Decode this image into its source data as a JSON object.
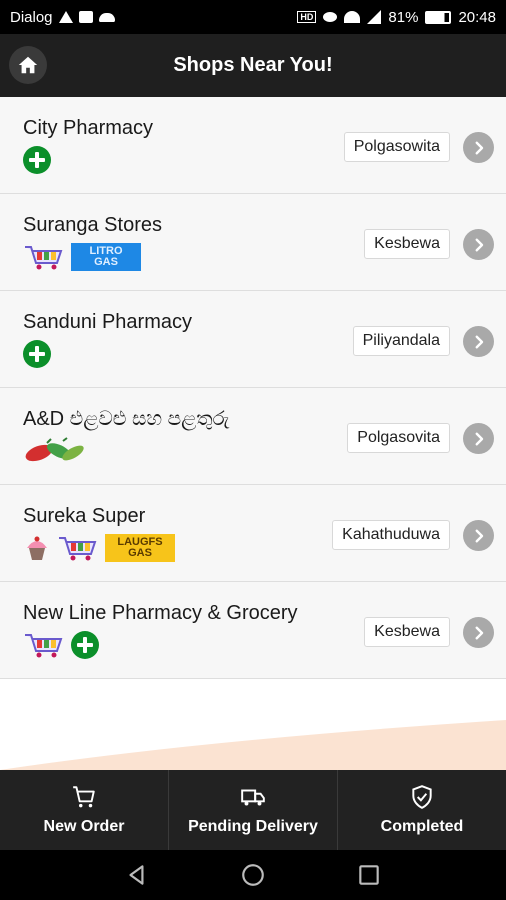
{
  "status_bar": {
    "carrier": "Dialog",
    "battery": "81%",
    "time": "20:48"
  },
  "header": {
    "title": "Shops Near You!"
  },
  "shops": [
    {
      "name": "City Pharmacy",
      "location": "Polgasowita",
      "badges": [
        "pharmacy-cross"
      ]
    },
    {
      "name": "Suranga Stores",
      "location": "Kesbewa",
      "badges": [
        "grocery-cart",
        "litro-gas"
      ]
    },
    {
      "name": "Sanduni Pharmacy",
      "location": "Piliyandala",
      "badges": [
        "pharmacy-cross"
      ]
    },
    {
      "name": "A&D එළවළු සහ පළතුරු",
      "location": "Polgasovita",
      "badges": [
        "vegetables"
      ]
    },
    {
      "name": "Sureka Super",
      "location": "Kahathuduwa",
      "badges": [
        "cupcake",
        "grocery-cart",
        "laugfs-gas"
      ]
    },
    {
      "name": "New Line Pharmacy & Grocery",
      "location": "Kesbewa",
      "badges": [
        "grocery-cart",
        "pharmacy-cross"
      ]
    }
  ],
  "gas_labels": {
    "litro": [
      "LITRO",
      "GAS"
    ],
    "laugfs": [
      "LAUGFS",
      "GAS"
    ]
  },
  "bottom_nav": [
    {
      "label": "New Order",
      "icon": "cart-icon"
    },
    {
      "label": "Pending Delivery",
      "icon": "truck-icon"
    },
    {
      "label": "Completed",
      "icon": "shield-check-icon"
    }
  ],
  "colors": {
    "header_bg": "#1f1f1f",
    "pharmacy_green": "#0b8f2a",
    "litro_blue": "#1e88e5",
    "laugfs_yellow": "#f7c41a",
    "accent_swoosh": "#fbe3d2"
  }
}
